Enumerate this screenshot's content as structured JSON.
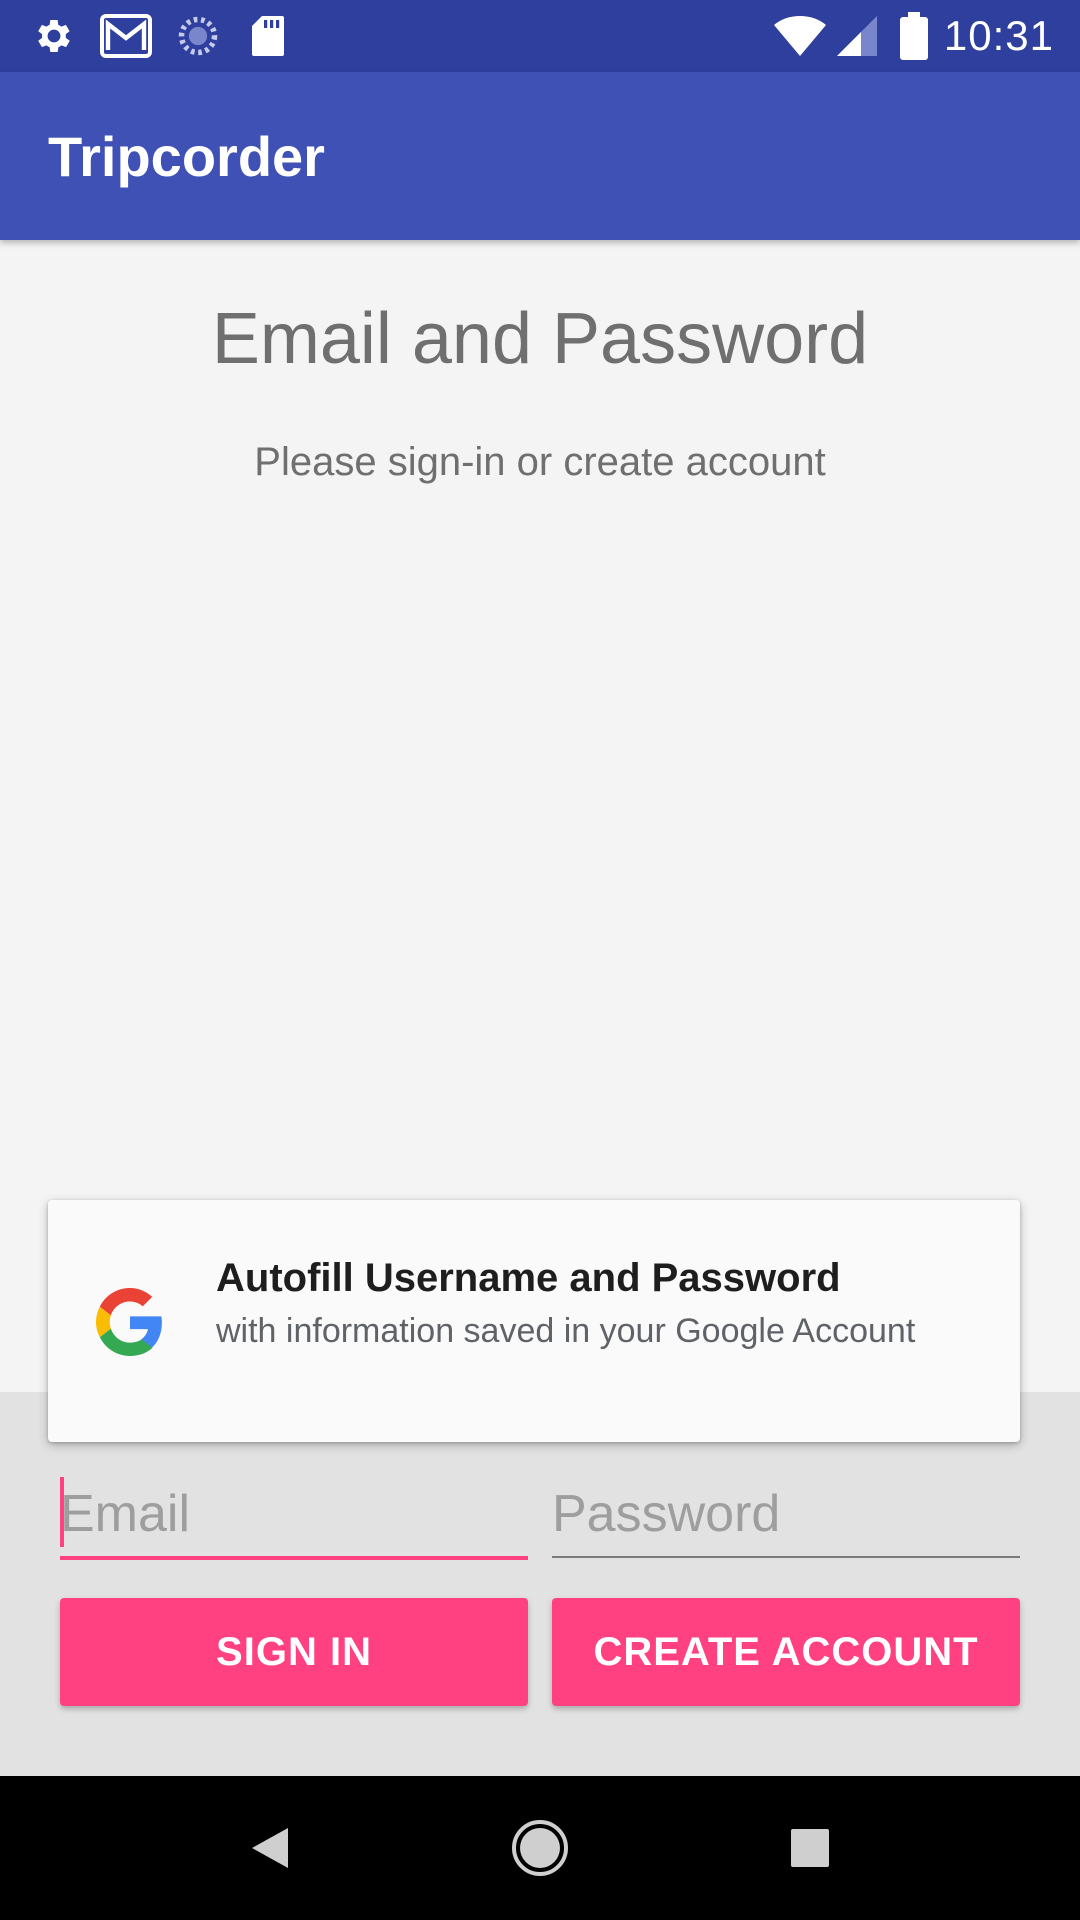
{
  "status_bar": {
    "time": "10:31",
    "left_icons": [
      "settings-icon",
      "gmail-icon",
      "sync-icon",
      "sd-card-icon"
    ],
    "right_icons": [
      "wifi-icon",
      "signal-icon",
      "battery-icon"
    ]
  },
  "app_bar": {
    "title": "Tripcorder"
  },
  "main": {
    "heading": "Email and Password",
    "subtitle": "Please sign-in or create account"
  },
  "autofill": {
    "title": "Autofill Username and Password",
    "description": "with information saved in your Google Account",
    "icon": "google-logo-icon"
  },
  "form": {
    "email_placeholder": "Email",
    "email_value": "",
    "password_placeholder": "Password",
    "password_value": "",
    "sign_in_label": "SIGN IN",
    "create_account_label": "CREATE ACCOUNT"
  },
  "nav_bar": {
    "buttons": [
      "back-icon",
      "home-icon",
      "recents-icon"
    ]
  },
  "colors": {
    "primary": "#3f51b5",
    "primary_dark": "#2f3f9e",
    "accent": "#ff4081"
  }
}
